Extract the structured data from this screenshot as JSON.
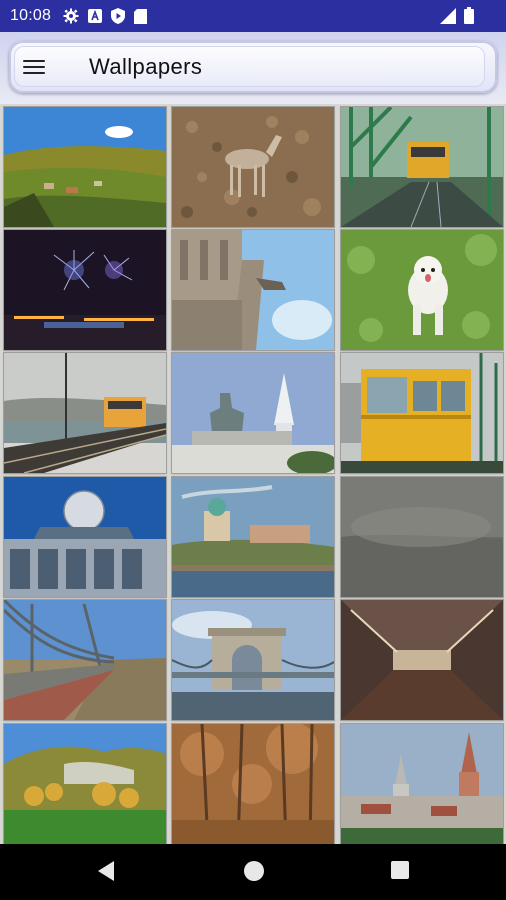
{
  "status_bar": {
    "time": "10:08",
    "left_icons": [
      "gear-icon",
      "a-box-icon",
      "shield-play-icon",
      "sd-card-icon"
    ],
    "right_icons": [
      "signal-icon",
      "battery-icon"
    ],
    "color": "#2b2fa0"
  },
  "toolbar": {
    "title": "Wallpapers",
    "menu_icon": "hamburger-menu-icon"
  },
  "wallpapers": [
    "autumn-hills-village",
    "deer-on-leaves",
    "tram-on-bridge",
    "night-fireworks-city",
    "gothic-tower-gargoyle",
    "white-dog-on-grass",
    "tram-by-river",
    "statue-and-white-tower",
    "yellow-tram-closeup",
    "glass-dome-building",
    "basilica-on-hill",
    "foggy-river",
    "chain-bridge-river-view",
    "chain-bridge-arch",
    "underground-tunnel",
    "green-hills-autumn",
    "autumn-forest",
    "city-church-spires"
  ],
  "navigation": {
    "back": "back-triangle-icon",
    "home": "home-circle-icon",
    "recents": "recents-square-icon"
  }
}
